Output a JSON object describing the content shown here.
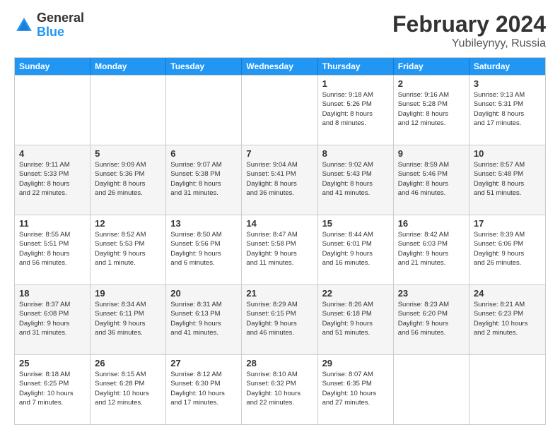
{
  "header": {
    "logo_line1": "General",
    "logo_line2": "Blue",
    "title": "February 2024",
    "subtitle": "Yubileynyy, Russia"
  },
  "calendar": {
    "days_of_week": [
      "Sunday",
      "Monday",
      "Tuesday",
      "Wednesday",
      "Thursday",
      "Friday",
      "Saturday"
    ],
    "rows": [
      [
        {
          "day": "",
          "info": ""
        },
        {
          "day": "",
          "info": ""
        },
        {
          "day": "",
          "info": ""
        },
        {
          "day": "",
          "info": ""
        },
        {
          "day": "1",
          "info": "Sunrise: 9:18 AM\nSunset: 5:26 PM\nDaylight: 8 hours\nand 8 minutes."
        },
        {
          "day": "2",
          "info": "Sunrise: 9:16 AM\nSunset: 5:28 PM\nDaylight: 8 hours\nand 12 minutes."
        },
        {
          "day": "3",
          "info": "Sunrise: 9:13 AM\nSunset: 5:31 PM\nDaylight: 8 hours\nand 17 minutes."
        }
      ],
      [
        {
          "day": "4",
          "info": "Sunrise: 9:11 AM\nSunset: 5:33 PM\nDaylight: 8 hours\nand 22 minutes."
        },
        {
          "day": "5",
          "info": "Sunrise: 9:09 AM\nSunset: 5:36 PM\nDaylight: 8 hours\nand 26 minutes."
        },
        {
          "day": "6",
          "info": "Sunrise: 9:07 AM\nSunset: 5:38 PM\nDaylight: 8 hours\nand 31 minutes."
        },
        {
          "day": "7",
          "info": "Sunrise: 9:04 AM\nSunset: 5:41 PM\nDaylight: 8 hours\nand 36 minutes."
        },
        {
          "day": "8",
          "info": "Sunrise: 9:02 AM\nSunset: 5:43 PM\nDaylight: 8 hours\nand 41 minutes."
        },
        {
          "day": "9",
          "info": "Sunrise: 8:59 AM\nSunset: 5:46 PM\nDaylight: 8 hours\nand 46 minutes."
        },
        {
          "day": "10",
          "info": "Sunrise: 8:57 AM\nSunset: 5:48 PM\nDaylight: 8 hours\nand 51 minutes."
        }
      ],
      [
        {
          "day": "11",
          "info": "Sunrise: 8:55 AM\nSunset: 5:51 PM\nDaylight: 8 hours\nand 56 minutes."
        },
        {
          "day": "12",
          "info": "Sunrise: 8:52 AM\nSunset: 5:53 PM\nDaylight: 9 hours\nand 1 minute."
        },
        {
          "day": "13",
          "info": "Sunrise: 8:50 AM\nSunset: 5:56 PM\nDaylight: 9 hours\nand 6 minutes."
        },
        {
          "day": "14",
          "info": "Sunrise: 8:47 AM\nSunset: 5:58 PM\nDaylight: 9 hours\nand 11 minutes."
        },
        {
          "day": "15",
          "info": "Sunrise: 8:44 AM\nSunset: 6:01 PM\nDaylight: 9 hours\nand 16 minutes."
        },
        {
          "day": "16",
          "info": "Sunrise: 8:42 AM\nSunset: 6:03 PM\nDaylight: 9 hours\nand 21 minutes."
        },
        {
          "day": "17",
          "info": "Sunrise: 8:39 AM\nSunset: 6:06 PM\nDaylight: 9 hours\nand 26 minutes."
        }
      ],
      [
        {
          "day": "18",
          "info": "Sunrise: 8:37 AM\nSunset: 6:08 PM\nDaylight: 9 hours\nand 31 minutes."
        },
        {
          "day": "19",
          "info": "Sunrise: 8:34 AM\nSunset: 6:11 PM\nDaylight: 9 hours\nand 36 minutes."
        },
        {
          "day": "20",
          "info": "Sunrise: 8:31 AM\nSunset: 6:13 PM\nDaylight: 9 hours\nand 41 minutes."
        },
        {
          "day": "21",
          "info": "Sunrise: 8:29 AM\nSunset: 6:15 PM\nDaylight: 9 hours\nand 46 minutes."
        },
        {
          "day": "22",
          "info": "Sunrise: 8:26 AM\nSunset: 6:18 PM\nDaylight: 9 hours\nand 51 minutes."
        },
        {
          "day": "23",
          "info": "Sunrise: 8:23 AM\nSunset: 6:20 PM\nDaylight: 9 hours\nand 56 minutes."
        },
        {
          "day": "24",
          "info": "Sunrise: 8:21 AM\nSunset: 6:23 PM\nDaylight: 10 hours\nand 2 minutes."
        }
      ],
      [
        {
          "day": "25",
          "info": "Sunrise: 8:18 AM\nSunset: 6:25 PM\nDaylight: 10 hours\nand 7 minutes."
        },
        {
          "day": "26",
          "info": "Sunrise: 8:15 AM\nSunset: 6:28 PM\nDaylight: 10 hours\nand 12 minutes."
        },
        {
          "day": "27",
          "info": "Sunrise: 8:12 AM\nSunset: 6:30 PM\nDaylight: 10 hours\nand 17 minutes."
        },
        {
          "day": "28",
          "info": "Sunrise: 8:10 AM\nSunset: 6:32 PM\nDaylight: 10 hours\nand 22 minutes."
        },
        {
          "day": "29",
          "info": "Sunrise: 8:07 AM\nSunset: 6:35 PM\nDaylight: 10 hours\nand 27 minutes."
        },
        {
          "day": "",
          "info": ""
        },
        {
          "day": "",
          "info": ""
        }
      ]
    ]
  }
}
